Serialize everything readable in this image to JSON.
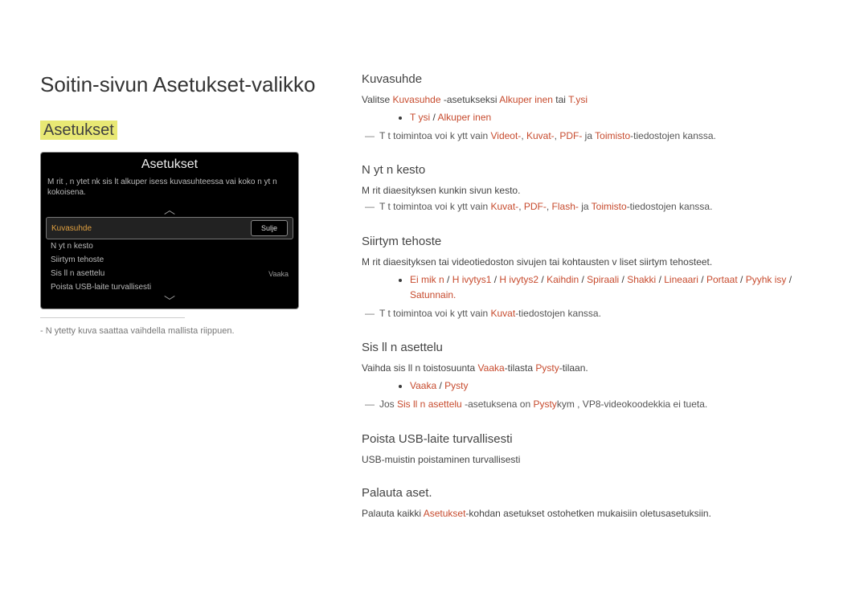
{
  "page_title": "Soitin-sivun Asetukset-valikko",
  "subtitle": "Asetukset",
  "panel": {
    "title": "Asetukset",
    "desc": "M rit , n ytet nk  sis lt  alkuper isess  kuvasuhteessa vai koko n yt n kokoisena.",
    "rows": [
      {
        "label": "Kuvasuhde",
        "value": "",
        "selected": true,
        "button": "Sulje"
      },
      {
        "label": "N yt n kesto",
        "value": ""
      },
      {
        "label": "Siirtym tehoste",
        "value": ""
      },
      {
        "label": "Sis ll n asettelu",
        "value": "Vaaka"
      },
      {
        "label": "Poista USB-laite turvallisesti",
        "value": ""
      }
    ]
  },
  "footnote": "N ytetty kuva saattaa vaihdella mallista riippuen.",
  "right": {
    "kuvasuhde": {
      "title": "Kuvasuhde",
      "line1_pre": "Valitse ",
      "line1_r1": "Kuvasuhde",
      "line1_mid": " -asetukseksi ",
      "line1_r2": "Alkuper inen",
      "line1_mid2": " tai ",
      "line1_r3": "T.ysi",
      "bullet_r1": "T ysi",
      "bullet_sep": " / ",
      "bullet_r2": "Alkuper inen",
      "note_pre": "T t  toimintoa voi k ytt   vain ",
      "note_r1": "Videot-",
      "note_s1": ", ",
      "note_r2": "Kuvat-",
      "note_s2": ", ",
      "note_r3": "PDF-",
      "note_mid": " ja ",
      "note_r4": "Toimisto",
      "note_suf": "-tiedostojen kanssa."
    },
    "kesto": {
      "title": "N yt n kesto",
      "desc": "M rit  diaesityksen kunkin sivun kesto.",
      "note_pre": "T t  toimintoa voi k ytt   vain ",
      "note_r1": "Kuvat-",
      "note_s1": ", ",
      "note_r2": "PDF-",
      "note_s2": ", ",
      "note_r3": "Flash-",
      "note_mid": " ja ",
      "note_r4": "Toimisto",
      "note_suf": "-tiedostojen kanssa."
    },
    "siirtym": {
      "title": "Siirtym tehoste",
      "desc": "M rit  diaesityksen tai videotiedoston sivujen tai kohtausten v liset siirtym tehosteet.",
      "opts": [
        "Ei mik n",
        "H ivytys1",
        "H ivytys2",
        "Kaihdin",
        "Spiraali",
        "Shakki",
        "Lineaari",
        "Portaat",
        "Pyyhk isy",
        "Satunnain."
      ],
      "sep": " / ",
      "note_pre": "T t  toimintoa voi k ytt   vain ",
      "note_r1": "Kuvat",
      "note_suf": "-tiedostojen kanssa."
    },
    "sisallon": {
      "title": "Sis ll n asettelu",
      "line_pre": "Vaihda sis ll n toistosuunta ",
      "line_r1": "Vaaka",
      "line_mid": "-tilasta ",
      "line_r2": "Pysty",
      "line_suf": "-tilaan.",
      "bul_r1": "Vaaka",
      "bul_sep": " / ",
      "bul_r2": "Pysty",
      "note_pre": "Jos ",
      "note_r1": "Sis ll n asettelu",
      "note_mid1": " -asetuksena on ",
      "note_r2": "Pysty",
      "note_suf": "kym , VP8-videokoodekkia ei tueta."
    },
    "usb": {
      "title": "Poista USB-laite turvallisesti",
      "desc": "USB-muistin poistaminen turvallisesti"
    },
    "palauta": {
      "title": "Palauta aset.",
      "line_pre": "Palauta kaikki ",
      "line_r1": "Asetukset",
      "line_suf": "-kohdan asetukset ostohetken mukaisiin oletusasetuksiin."
    }
  }
}
